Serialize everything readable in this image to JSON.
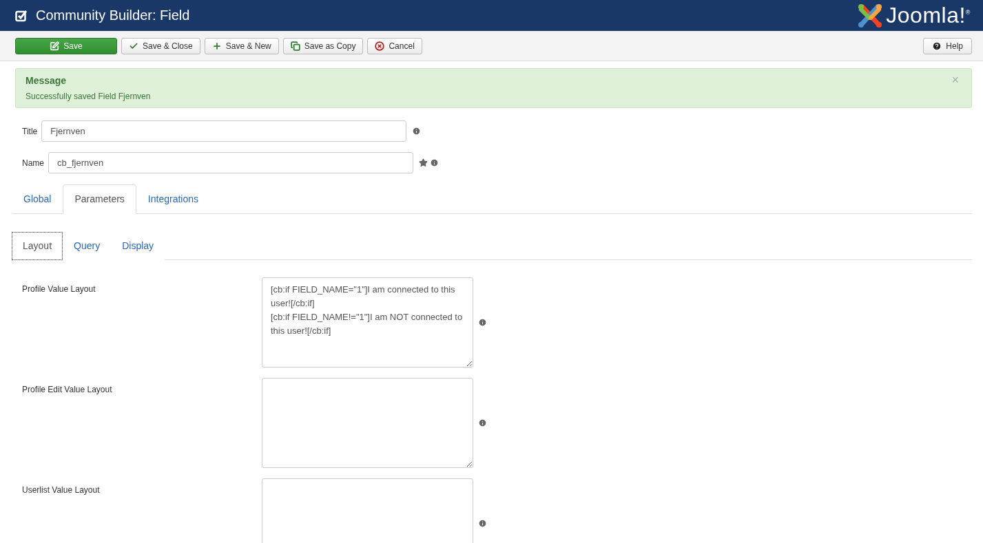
{
  "header": {
    "title": "Community Builder: Field",
    "logo_text": "Joomla!$^{®}$"
  },
  "toolbar": {
    "buttons": [
      {
        "label": "Save",
        "kind": "primary"
      },
      {
        "label": "Save & Close",
        "kind": "default"
      },
      {
        "label": "Save & New",
        "kind": "default"
      },
      {
        "label": "Save as Copy",
        "kind": "default"
      },
      {
        "label": "Cancel",
        "kind": "default"
      }
    ],
    "help": {
      "label": "Help"
    }
  },
  "message": {
    "heading": "Message",
    "text": "Successfully saved Field Fjernven",
    "close": "×"
  },
  "fields": [
    {
      "label": "Title",
      "value": "Fjernven",
      "required": false
    },
    {
      "label": "Name",
      "value": "cb_fjernven",
      "required": true
    }
  ],
  "tabs": [
    {
      "label": "Global",
      "selected": false
    },
    {
      "label": "Parameters",
      "selected": true
    },
    {
      "label": "Integrations",
      "selected": false
    }
  ],
  "subtabs": [
    {
      "label": "Layout",
      "selected": true
    },
    {
      "label": "Query",
      "selected": false
    },
    {
      "label": "Display",
      "selected": false
    }
  ],
  "layout_rows": [
    {
      "label": "Profile Value Layout",
      "value": "[cb:if FIELD_NAME=\"1\"]I am connected to this user![/cb:if]\n[cb:if FIELD_NAME!=\"1\"]I am NOT connected to this user![/cb:if]"
    },
    {
      "label": "Profile Edit Value Layout"
    },
    {
      "label": "Userlist Value Layout"
    }
  ]
}
